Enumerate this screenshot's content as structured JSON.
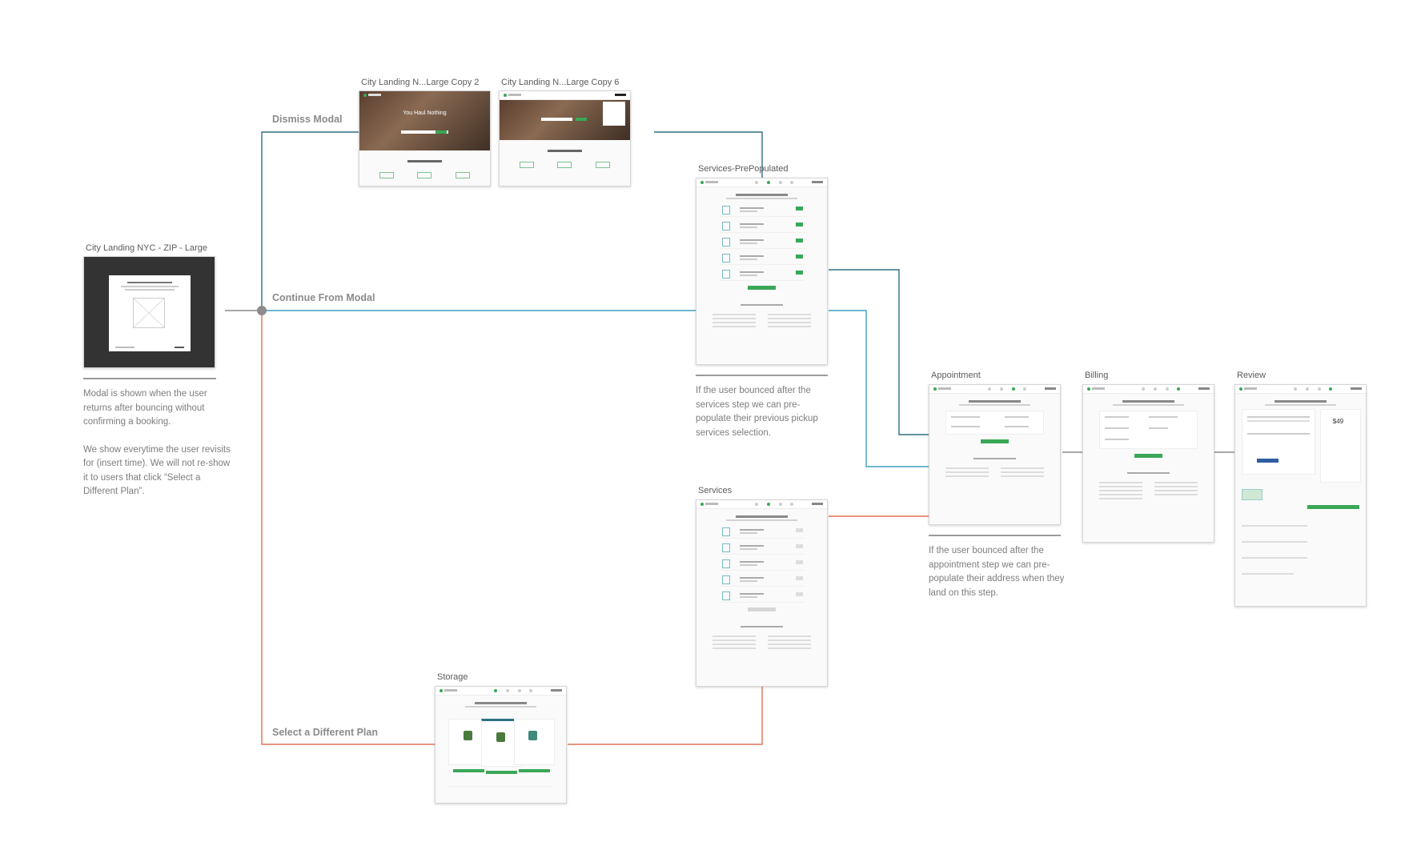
{
  "labels": {
    "city_landing_modal": "City Landing NYC - ZIP - Large",
    "landing_copy2": "City Landing N...Large Copy 2",
    "landing_copy6": "City Landing N...Large Copy 6",
    "services_prepopulated": "Services-PrePopulated",
    "services": "Services",
    "storage": "Storage",
    "appointment": "Appointment",
    "billing": "Billing",
    "review": "Review"
  },
  "flows": {
    "dismiss": "Dismiss Modal",
    "continue": "Continue From Modal",
    "select_plan": "Select a Different Plan"
  },
  "notes": {
    "modal_p1": "Modal is shown when the user returns after bouncing without confirming a booking.",
    "modal_p2": "We show everytime the user revisits for (insert time). We will not re-show it to users that click “Select a Different Plan”.",
    "services_note": "If the user bounced after the services step we can pre-populate their previous pickup services selection.",
    "appointment_note": "If the user bounced after the appointment step we can pre-populate their address when they land on this step."
  },
  "artboard_text": {
    "hero_headline": "You Haul Nothing",
    "review_price": "$49"
  },
  "colors": {
    "dismiss_line": "#2f6f82",
    "continue_line": "#3ea0c0",
    "select_line": "#e07056",
    "neutral_line": "#8c8c8c",
    "brand_green": "#3aa757"
  }
}
